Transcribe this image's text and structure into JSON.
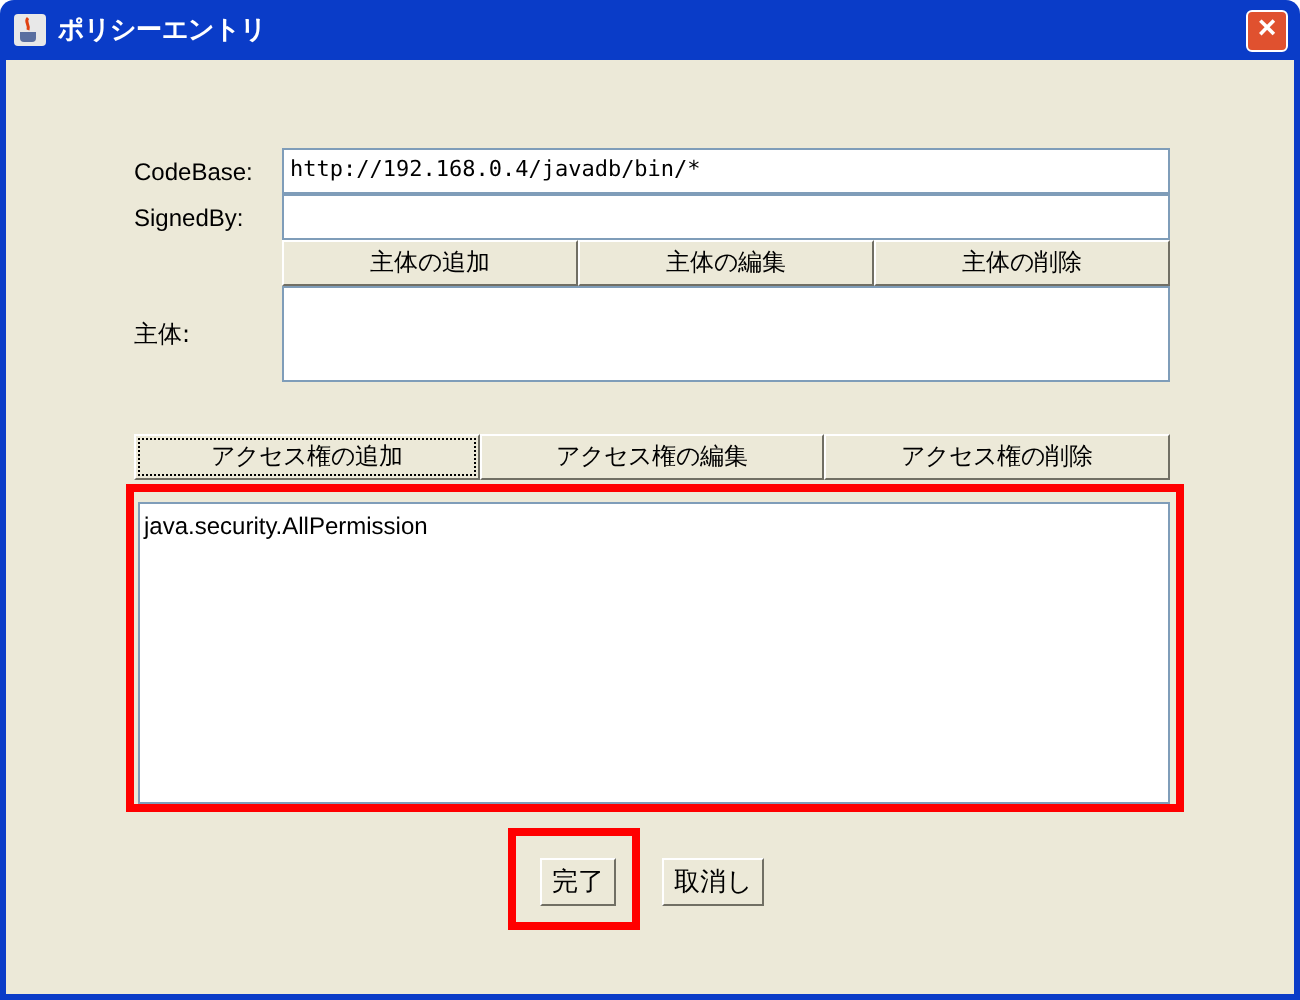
{
  "window": {
    "title": "ポリシーエントリ",
    "close": "×"
  },
  "fields": [
    {
      "label": "CodeBase:",
      "value": "http://192.168.0.4/javadb/bin/*"
    },
    {
      "label": "SignedBy:"
    }
  ],
  "principal_buttons": [
    "主体の追加",
    "主体の編集",
    "主体の削除"
  ],
  "principal_label": "主体:",
  "permission_buttons": [
    {
      "label": "アクセス権の追加",
      "focused": true
    },
    {
      "label": "アクセス権の編集",
      "focused": false
    },
    {
      "label": "アクセス権の削除",
      "focused": false
    }
  ],
  "permissions": [
    "java.security.AllPermission"
  ],
  "buttons": [
    "完了",
    "取消し"
  ]
}
